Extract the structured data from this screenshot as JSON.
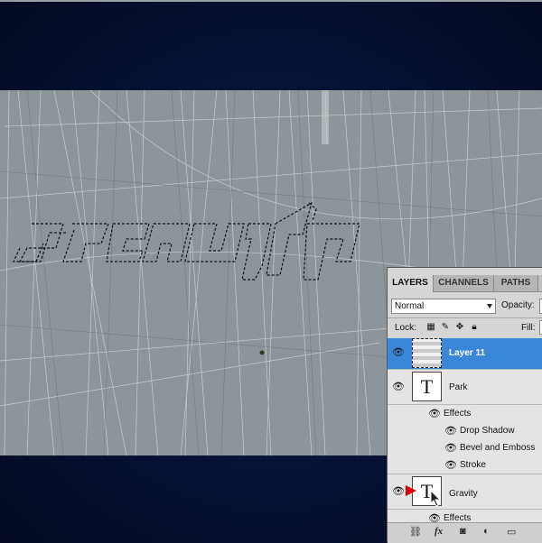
{
  "panel": {
    "tabs": [
      "LAYERS",
      "CHANNELS",
      "PATHS"
    ],
    "blend_mode": "Normal",
    "opacity_label": "Opacity:",
    "lock_label": "Lock:",
    "fill_label": "Fill:",
    "layers": [
      {
        "name": "Layer 11",
        "selected": true
      },
      {
        "name": "Park",
        "thumb": "T"
      },
      {
        "name": "Gravity",
        "thumb": "T"
      }
    ],
    "effects_label": "Effects",
    "park_effects": [
      "Drop Shadow",
      "Bevel and Emboss",
      "Stroke"
    ],
    "bottom_icons": [
      "link-icon",
      "fx-icon",
      "mask-icon",
      "adjustment-icon",
      "group-icon"
    ]
  }
}
